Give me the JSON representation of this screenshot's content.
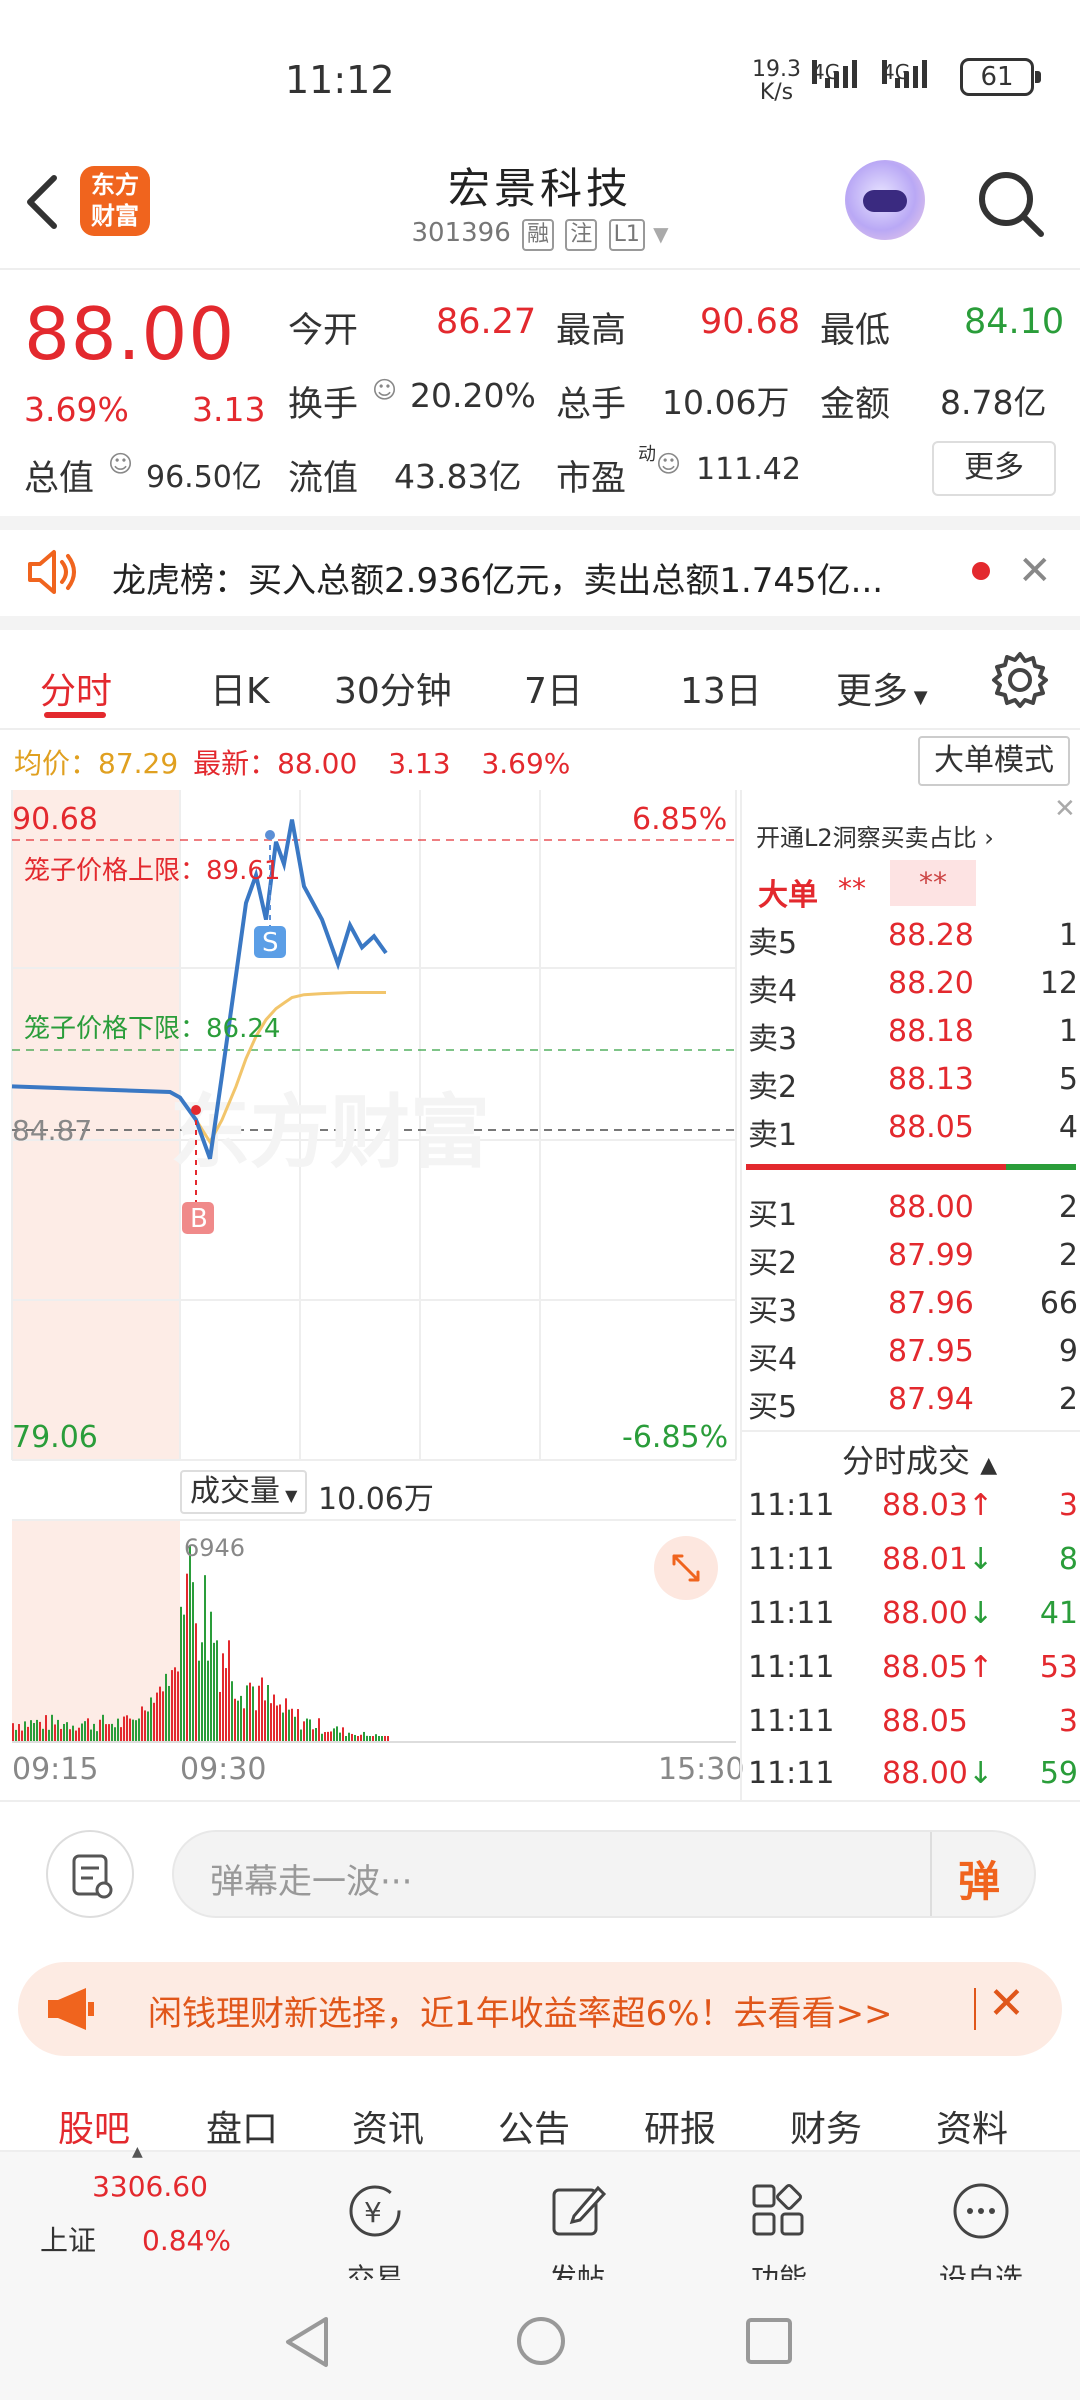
{
  "status_bar": {
    "time": "11:12",
    "net_speed_value": "19.3",
    "net_speed_unit": "K/s",
    "sim1": "4G",
    "sim2": "4G",
    "battery": "61"
  },
  "header": {
    "logo_text_1": "东方",
    "logo_text_2": "财富",
    "title": "宏景科技",
    "code": "301396",
    "tags": [
      "融",
      "注",
      "L1"
    ]
  },
  "quote": {
    "price": "88.00",
    "change_pct": "3.69%",
    "change": "3.13",
    "open_label": "今开",
    "open": "86.27",
    "high_label": "最高",
    "high": "90.68",
    "low_label": "最低",
    "low": "84.10",
    "turnover_label": "换手",
    "turnover": "20.20%",
    "volume_label": "总手",
    "volume": "10.06万",
    "amount_label": "金额",
    "amount": "8.78亿",
    "mcap_label": "总值",
    "mcap": "96.50亿",
    "float_label": "流值",
    "float": "43.83亿",
    "pe_label": "市盈",
    "pe_sup": "动",
    "pe": "111.42",
    "more": "更多"
  },
  "news": {
    "text": "龙虎榜：买入总额2.936亿元，卖出总额1.745亿..."
  },
  "tabs": [
    "分时",
    "日K",
    "30分钟",
    "7日",
    "13日",
    "更多"
  ],
  "info_line": {
    "avg_label": "均价：",
    "avg": "87.29",
    "latest_label": "最新：",
    "latest": "88.00",
    "change": "3.13",
    "pct": "3.69%"
  },
  "big_order_mode": "大单模式",
  "chart": {
    "price_high": "90.68",
    "pct_high": "6.85%",
    "price_low": "79.06",
    "pct_low": "-6.85%",
    "prev_close": "84.87",
    "upper_limit": "笼子价格上限：89.61",
    "lower_limit": "笼子价格下限：86.24",
    "watermark": "东方财富",
    "marker_s": "S",
    "marker_b": "B",
    "volume_label": "成交量",
    "volume_total": "10.06万",
    "volume_max": "6946",
    "time_start": "09:15",
    "time_mid": "09:30",
    "time_end": "15:30"
  },
  "chart_data": {
    "type": "line",
    "x": [
      "09:15",
      "09:25",
      "09:26",
      "09:30",
      "09:33",
      "09:36",
      "09:40",
      "09:44",
      "09:48",
      "09:52",
      "09:56",
      "10:00",
      "10:05",
      "10:10",
      "10:20",
      "10:30",
      "10:40",
      "10:50",
      "11:00",
      "11:11"
    ],
    "series": [
      {
        "values": [
          85.6,
          85.5,
          85.4,
          85.0,
          84.3,
          85.8,
          87.6,
          88.9,
          89.4,
          88.6,
          90.0,
          89.6,
          90.4,
          89.2,
          88.6,
          87.8,
          88.5,
          88.1,
          88.3,
          88.0
        ]
      },
      {
        "values": [
          null,
          null,
          null,
          85.0,
          84.6,
          85.0,
          85.6,
          86.1,
          86.5,
          86.8,
          87.0,
          87.1,
          87.2,
          87.25,
          87.27,
          87.28,
          87.29,
          87.29,
          87.29,
          87.29
        ]
      }
    ],
    "ylim": [
      79.06,
      90.68
    ]
  },
  "orderbook": {
    "promo": "开通L2洞察买卖占比",
    "big_label": "大单",
    "big_v1": "**",
    "big_v2": "**",
    "asks": [
      {
        "label": "卖5",
        "price": "88.28",
        "vol": "1"
      },
      {
        "label": "卖4",
        "price": "88.20",
        "vol": "12"
      },
      {
        "label": "卖3",
        "price": "88.18",
        "vol": "1"
      },
      {
        "label": "卖2",
        "price": "88.13",
        "vol": "5"
      },
      {
        "label": "卖1",
        "price": "88.05",
        "vol": "4"
      }
    ],
    "bids": [
      {
        "label": "买1",
        "price": "88.00",
        "vol": "2"
      },
      {
        "label": "买2",
        "price": "87.99",
        "vol": "2"
      },
      {
        "label": "买3",
        "price": "87.96",
        "vol": "66"
      },
      {
        "label": "买4",
        "price": "87.95",
        "vol": "9"
      },
      {
        "label": "买5",
        "price": "87.94",
        "vol": "2"
      }
    ],
    "ticks_title": "分时成交",
    "ticks": [
      {
        "time": "11:11",
        "price": "88.03",
        "arrow": "↑",
        "vol": "3",
        "dir": "up"
      },
      {
        "time": "11:11",
        "price": "88.01",
        "arrow": "↓",
        "vol": "8",
        "dir": "down"
      },
      {
        "time": "11:11",
        "price": "88.00",
        "arrow": "↓",
        "vol": "41",
        "dir": "down"
      },
      {
        "time": "11:11",
        "price": "88.05",
        "arrow": "↑",
        "vol": "53",
        "dir": "up"
      },
      {
        "time": "11:11",
        "price": "88.05",
        "arrow": "",
        "vol": "3",
        "dir": "flat"
      },
      {
        "time": "11:11",
        "price": "88.00",
        "arrow": "↓",
        "vol": "59",
        "dir": "down"
      }
    ]
  },
  "comment": {
    "placeholder": "弹幕走一波···",
    "danmu_button": "弹"
  },
  "banner": {
    "text": "闲钱理财新选择，近1年收益率超6%！去看看>>"
  },
  "nav_tabs": [
    "股吧",
    "盘口",
    "资讯",
    "公告",
    "研报",
    "财务",
    "资料"
  ],
  "tab_bar": {
    "index_value": "3306.60",
    "index_name": "上证",
    "index_pct": "0.84%",
    "items": [
      "交易",
      "发帖",
      "功能",
      "设自选"
    ]
  },
  "colors": {
    "up": "#e3292e",
    "down": "#2a9d3a",
    "accent": "#f0641e",
    "price_line": "#3a78c4",
    "avg_line": "#f2c56b"
  }
}
